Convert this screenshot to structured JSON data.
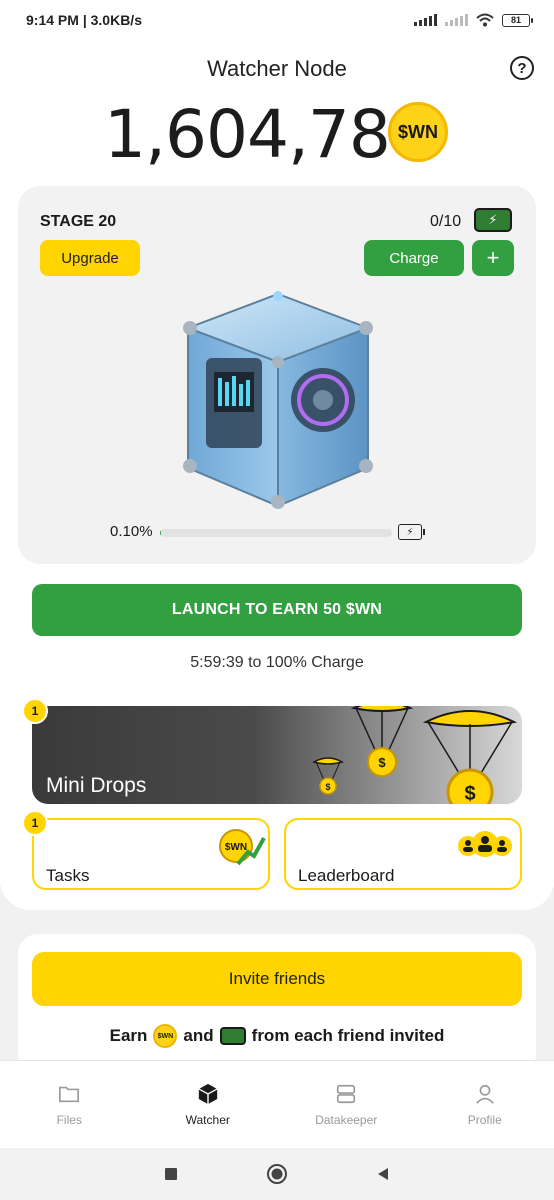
{
  "status_bar": {
    "time": "9:14 PM",
    "speed": "3.0KB/s",
    "battery": "81"
  },
  "header": {
    "title": "Watcher Node",
    "help_icon": "question-circle-icon"
  },
  "balance": {
    "amount": "1,604,780",
    "coin_label": "$WN"
  },
  "stage": {
    "label": "STAGE 20",
    "charges": "0/10",
    "upgrade_label": "Upgrade",
    "charge_label": "Charge",
    "plus_label": "+",
    "progress_text": "0.10%",
    "progress_value": 0.001
  },
  "launch": {
    "button_label": "LAUNCH TO EARN 50 $WN",
    "timer_text": "5:59:39  to 100% Charge"
  },
  "mini_drops": {
    "label": "Mini Drops",
    "badge": "1",
    "coin_symbol": "$"
  },
  "tiles": {
    "tasks": {
      "label": "Tasks",
      "badge": "1",
      "coin_label": "$WN"
    },
    "leaderboard": {
      "label": "Leaderboard"
    }
  },
  "invite": {
    "button_label": "Invite friends",
    "earn_prefix": "Earn",
    "earn_and": "and",
    "earn_suffix": "from each friend invited",
    "coin_label": "$WN"
  },
  "bottom_nav": [
    {
      "label": "Files",
      "icon": "folder-icon",
      "active": false
    },
    {
      "label": "Watcher",
      "icon": "cube-icon",
      "active": true
    },
    {
      "label": "Datakeeper",
      "icon": "server-icon",
      "active": false
    },
    {
      "label": "Profile",
      "icon": "person-icon",
      "active": false
    }
  ],
  "colors": {
    "green": "#32a041",
    "yellow": "#ffd400",
    "dark": "#1a1a1a"
  }
}
